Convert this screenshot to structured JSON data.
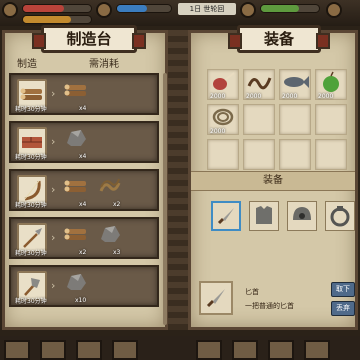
{
  "hud": {
    "day_label": "1日 世轮回"
  },
  "craft": {
    "title": "制造台",
    "col_make": "制造",
    "col_need": "需消耗",
    "rows": [
      {
        "product": "log-bundle-icon",
        "time": "耗时30分钟",
        "materials": [
          {
            "icon": "log-bundle-icon",
            "qty": "x4"
          }
        ]
      },
      {
        "product": "brick-icon",
        "time": "耗时30分钟",
        "materials": [
          {
            "icon": "stone-icon",
            "qty": "x4"
          }
        ]
      },
      {
        "product": "bow-icon",
        "time": "耗时30分钟",
        "materials": [
          {
            "icon": "log-bundle-icon",
            "qty": "x4"
          },
          {
            "icon": "rope-icon",
            "qty": "x2"
          }
        ]
      },
      {
        "product": "spear-icon",
        "time": "耗时30分钟",
        "materials": [
          {
            "icon": "log-bundle-icon",
            "qty": "x2"
          },
          {
            "icon": "stone-icon",
            "qty": "x3"
          }
        ]
      },
      {
        "product": "stone-tool-icon",
        "time": "耗时30分钟",
        "materials": [
          {
            "icon": "stone-icon",
            "qty": "x10"
          }
        ]
      }
    ]
  },
  "equip": {
    "title": "装备",
    "inventory": [
      {
        "icon": "meat-icon",
        "count": "2000"
      },
      {
        "icon": "worm-icon",
        "count": "2000"
      },
      {
        "icon": "fish-icon",
        "count": "2000"
      },
      {
        "icon": "apple-icon",
        "count": "2000"
      },
      {
        "icon": "rope-coil-icon",
        "count": "2000"
      }
    ],
    "section_label": "装备",
    "slots": [
      "dagger-icon",
      "armor-icon",
      "helmet-icon",
      "ring-icon"
    ],
    "detail": {
      "name": "匕首",
      "desc": "一把普通的匕首"
    },
    "buttons": {
      "unequip": "取下",
      "discard": "丢弃"
    }
  }
}
